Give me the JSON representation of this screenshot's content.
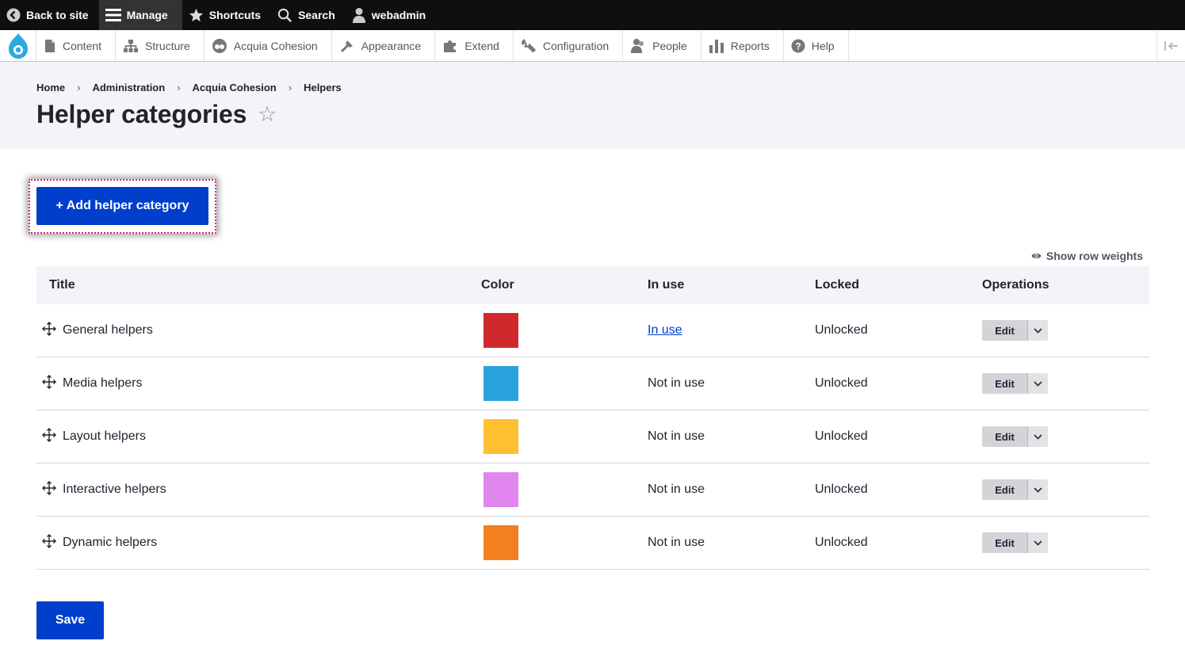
{
  "toolbar": {
    "back_label": "Back to site",
    "manage_label": "Manage",
    "shortcuts_label": "Shortcuts",
    "search_label": "Search",
    "user_label": "webadmin"
  },
  "tray": {
    "items": [
      {
        "label": "Content",
        "icon": "content-icon"
      },
      {
        "label": "Structure",
        "icon": "structure-icon"
      },
      {
        "label": "Acquia Cohesion",
        "icon": "cohesion-icon"
      },
      {
        "label": "Appearance",
        "icon": "appearance-icon"
      },
      {
        "label": "Extend",
        "icon": "extend-icon"
      },
      {
        "label": "Configuration",
        "icon": "wrench-icon"
      },
      {
        "label": "People",
        "icon": "people-icon"
      },
      {
        "label": "Reports",
        "icon": "reports-icon"
      },
      {
        "label": "Help",
        "icon": "help-icon"
      }
    ]
  },
  "breadcrumb": [
    "Home",
    "Administration",
    "Acquia Cohesion",
    "Helpers"
  ],
  "page": {
    "title": "Helper categories",
    "add_button": "+ Add helper category",
    "row_weights": "Show row weights",
    "save": "Save"
  },
  "table": {
    "headers": [
      "Title",
      "Color",
      "In use",
      "Locked",
      "Operations"
    ],
    "rows": [
      {
        "title": "General helpers",
        "color": "#d0292c",
        "in_use": "In use",
        "in_use_link": true,
        "locked": "Unlocked",
        "op": "Edit"
      },
      {
        "title": "Media helpers",
        "color": "#29a3df",
        "in_use": "Not in use",
        "in_use_link": false,
        "locked": "Unlocked",
        "op": "Edit"
      },
      {
        "title": "Layout helpers",
        "color": "#fec030",
        "in_use": "Not in use",
        "in_use_link": false,
        "locked": "Unlocked",
        "op": "Edit"
      },
      {
        "title": "Interactive helpers",
        "color": "#e186ee",
        "in_use": "Not in use",
        "in_use_link": false,
        "locked": "Unlocked",
        "op": "Edit"
      },
      {
        "title": "Dynamic helpers",
        "color": "#f47f1f",
        "in_use": "Not in use",
        "in_use_link": false,
        "locked": "Unlocked",
        "op": "Edit"
      }
    ]
  },
  "colors": {
    "primary": "#003ecc",
    "focus_ring": "#e0197d"
  }
}
